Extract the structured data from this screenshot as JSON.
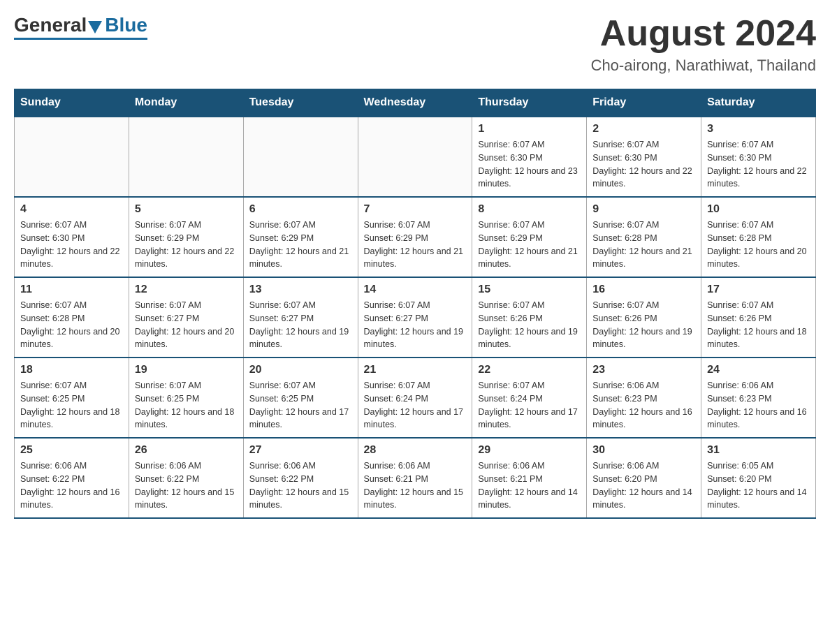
{
  "header": {
    "logo_general": "General",
    "logo_blue": "Blue",
    "month_title": "August 2024",
    "location": "Cho-airong, Narathiwat, Thailand"
  },
  "days_of_week": [
    "Sunday",
    "Monday",
    "Tuesday",
    "Wednesday",
    "Thursday",
    "Friday",
    "Saturday"
  ],
  "weeks": [
    [
      {
        "day": "",
        "sunrise": "",
        "sunset": "",
        "daylight": ""
      },
      {
        "day": "",
        "sunrise": "",
        "sunset": "",
        "daylight": ""
      },
      {
        "day": "",
        "sunrise": "",
        "sunset": "",
        "daylight": ""
      },
      {
        "day": "",
        "sunrise": "",
        "sunset": "",
        "daylight": ""
      },
      {
        "day": "1",
        "sunrise": "Sunrise: 6:07 AM",
        "sunset": "Sunset: 6:30 PM",
        "daylight": "Daylight: 12 hours and 23 minutes."
      },
      {
        "day": "2",
        "sunrise": "Sunrise: 6:07 AM",
        "sunset": "Sunset: 6:30 PM",
        "daylight": "Daylight: 12 hours and 22 minutes."
      },
      {
        "day": "3",
        "sunrise": "Sunrise: 6:07 AM",
        "sunset": "Sunset: 6:30 PM",
        "daylight": "Daylight: 12 hours and 22 minutes."
      }
    ],
    [
      {
        "day": "4",
        "sunrise": "Sunrise: 6:07 AM",
        "sunset": "Sunset: 6:30 PM",
        "daylight": "Daylight: 12 hours and 22 minutes."
      },
      {
        "day": "5",
        "sunrise": "Sunrise: 6:07 AM",
        "sunset": "Sunset: 6:29 PM",
        "daylight": "Daylight: 12 hours and 22 minutes."
      },
      {
        "day": "6",
        "sunrise": "Sunrise: 6:07 AM",
        "sunset": "Sunset: 6:29 PM",
        "daylight": "Daylight: 12 hours and 21 minutes."
      },
      {
        "day": "7",
        "sunrise": "Sunrise: 6:07 AM",
        "sunset": "Sunset: 6:29 PM",
        "daylight": "Daylight: 12 hours and 21 minutes."
      },
      {
        "day": "8",
        "sunrise": "Sunrise: 6:07 AM",
        "sunset": "Sunset: 6:29 PM",
        "daylight": "Daylight: 12 hours and 21 minutes."
      },
      {
        "day": "9",
        "sunrise": "Sunrise: 6:07 AM",
        "sunset": "Sunset: 6:28 PM",
        "daylight": "Daylight: 12 hours and 21 minutes."
      },
      {
        "day": "10",
        "sunrise": "Sunrise: 6:07 AM",
        "sunset": "Sunset: 6:28 PM",
        "daylight": "Daylight: 12 hours and 20 minutes."
      }
    ],
    [
      {
        "day": "11",
        "sunrise": "Sunrise: 6:07 AM",
        "sunset": "Sunset: 6:28 PM",
        "daylight": "Daylight: 12 hours and 20 minutes."
      },
      {
        "day": "12",
        "sunrise": "Sunrise: 6:07 AM",
        "sunset": "Sunset: 6:27 PM",
        "daylight": "Daylight: 12 hours and 20 minutes."
      },
      {
        "day": "13",
        "sunrise": "Sunrise: 6:07 AM",
        "sunset": "Sunset: 6:27 PM",
        "daylight": "Daylight: 12 hours and 19 minutes."
      },
      {
        "day": "14",
        "sunrise": "Sunrise: 6:07 AM",
        "sunset": "Sunset: 6:27 PM",
        "daylight": "Daylight: 12 hours and 19 minutes."
      },
      {
        "day": "15",
        "sunrise": "Sunrise: 6:07 AM",
        "sunset": "Sunset: 6:26 PM",
        "daylight": "Daylight: 12 hours and 19 minutes."
      },
      {
        "day": "16",
        "sunrise": "Sunrise: 6:07 AM",
        "sunset": "Sunset: 6:26 PM",
        "daylight": "Daylight: 12 hours and 19 minutes."
      },
      {
        "day": "17",
        "sunrise": "Sunrise: 6:07 AM",
        "sunset": "Sunset: 6:26 PM",
        "daylight": "Daylight: 12 hours and 18 minutes."
      }
    ],
    [
      {
        "day": "18",
        "sunrise": "Sunrise: 6:07 AM",
        "sunset": "Sunset: 6:25 PM",
        "daylight": "Daylight: 12 hours and 18 minutes."
      },
      {
        "day": "19",
        "sunrise": "Sunrise: 6:07 AM",
        "sunset": "Sunset: 6:25 PM",
        "daylight": "Daylight: 12 hours and 18 minutes."
      },
      {
        "day": "20",
        "sunrise": "Sunrise: 6:07 AM",
        "sunset": "Sunset: 6:25 PM",
        "daylight": "Daylight: 12 hours and 17 minutes."
      },
      {
        "day": "21",
        "sunrise": "Sunrise: 6:07 AM",
        "sunset": "Sunset: 6:24 PM",
        "daylight": "Daylight: 12 hours and 17 minutes."
      },
      {
        "day": "22",
        "sunrise": "Sunrise: 6:07 AM",
        "sunset": "Sunset: 6:24 PM",
        "daylight": "Daylight: 12 hours and 17 minutes."
      },
      {
        "day": "23",
        "sunrise": "Sunrise: 6:06 AM",
        "sunset": "Sunset: 6:23 PM",
        "daylight": "Daylight: 12 hours and 16 minutes."
      },
      {
        "day": "24",
        "sunrise": "Sunrise: 6:06 AM",
        "sunset": "Sunset: 6:23 PM",
        "daylight": "Daylight: 12 hours and 16 minutes."
      }
    ],
    [
      {
        "day": "25",
        "sunrise": "Sunrise: 6:06 AM",
        "sunset": "Sunset: 6:22 PM",
        "daylight": "Daylight: 12 hours and 16 minutes."
      },
      {
        "day": "26",
        "sunrise": "Sunrise: 6:06 AM",
        "sunset": "Sunset: 6:22 PM",
        "daylight": "Daylight: 12 hours and 15 minutes."
      },
      {
        "day": "27",
        "sunrise": "Sunrise: 6:06 AM",
        "sunset": "Sunset: 6:22 PM",
        "daylight": "Daylight: 12 hours and 15 minutes."
      },
      {
        "day": "28",
        "sunrise": "Sunrise: 6:06 AM",
        "sunset": "Sunset: 6:21 PM",
        "daylight": "Daylight: 12 hours and 15 minutes."
      },
      {
        "day": "29",
        "sunrise": "Sunrise: 6:06 AM",
        "sunset": "Sunset: 6:21 PM",
        "daylight": "Daylight: 12 hours and 14 minutes."
      },
      {
        "day": "30",
        "sunrise": "Sunrise: 6:06 AM",
        "sunset": "Sunset: 6:20 PM",
        "daylight": "Daylight: 12 hours and 14 minutes."
      },
      {
        "day": "31",
        "sunrise": "Sunrise: 6:05 AM",
        "sunset": "Sunset: 6:20 PM",
        "daylight": "Daylight: 12 hours and 14 minutes."
      }
    ]
  ]
}
